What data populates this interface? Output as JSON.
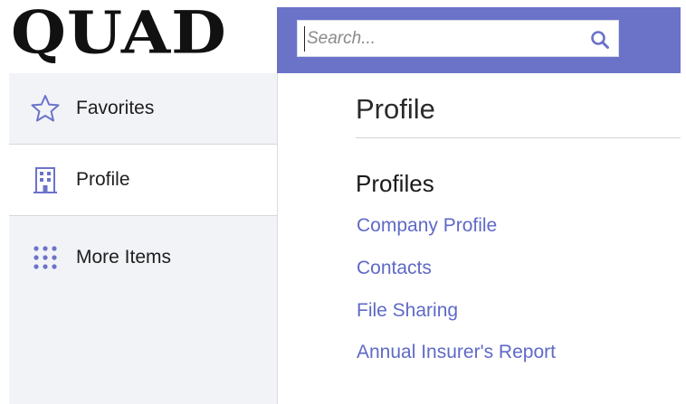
{
  "brand": {
    "logo_text": "QUAD"
  },
  "search": {
    "placeholder": "Search...",
    "value": ""
  },
  "sidebar": {
    "items": [
      {
        "label": "Favorites",
        "icon": "star-icon"
      },
      {
        "label": "Profile",
        "icon": "building-icon"
      },
      {
        "label": "More Items",
        "icon": "grid-dots-icon"
      }
    ]
  },
  "main": {
    "title": "Profile",
    "section_heading": "Profiles",
    "links": [
      {
        "label": "Company Profile"
      },
      {
        "label": "Contacts"
      },
      {
        "label": "File Sharing"
      },
      {
        "label": "Annual Insurer's Report"
      }
    ]
  },
  "colors": {
    "header_bg": "#6b73c9",
    "link": "#5f69c6",
    "sidebar_bg": "#f2f3f7",
    "icon_accent": "#6b73c9"
  }
}
